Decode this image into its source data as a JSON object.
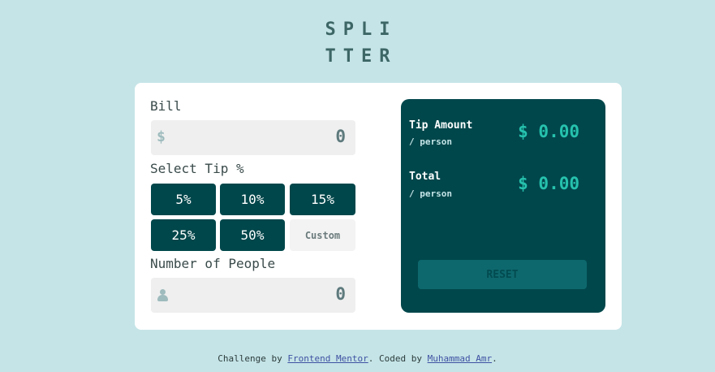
{
  "logo": {
    "line1": "SPLI",
    "line2": "TTER"
  },
  "bill": {
    "label": "Bill",
    "currency_symbol": "$",
    "value": "0"
  },
  "tip": {
    "label": "Select Tip %",
    "options": [
      "5%",
      "10%",
      "15%",
      "25%",
      "50%"
    ],
    "custom_label": "Custom"
  },
  "people": {
    "label": "Number of People",
    "value": "0",
    "icon": "person-icon"
  },
  "results": {
    "tip_amount_label": "Tip Amount",
    "tip_amount_sub": "/ person",
    "tip_amount_value": "$ 0.00",
    "total_label": "Total",
    "total_sub": "/ person",
    "total_value": "$ 0.00",
    "reset_label": "RESET"
  },
  "footer": {
    "prefix": "Challenge by ",
    "link1": "Frontend Mentor",
    "middle": ". Coded by ",
    "link2": "Muhammad Amr",
    "suffix": "."
  },
  "colors": {
    "background": "#c5e4e7",
    "dark_cyan": "#00474b",
    "strong_cyan": "#26c2ae"
  }
}
